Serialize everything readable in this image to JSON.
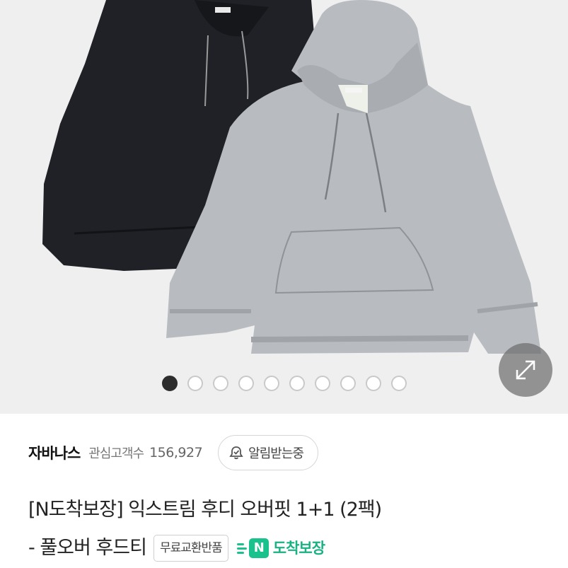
{
  "gallery": {
    "image": "product-photo-gray-black-hoodies",
    "slide_count": 10,
    "active_index": 0,
    "expand_icon": "expand-arrows-icon"
  },
  "store": {
    "name": "자바나스",
    "followers_label": "관심고객수",
    "followers_count": "156,927",
    "alarm_icon": "bell-icon",
    "alarm_label": "알림받는중"
  },
  "product": {
    "title_line1": "[N도착보장] 익스트림 후디 오버핏 1+1 (2팩)",
    "title_line2": "- 풀오버 후드티",
    "badge_return": "무료교환반품",
    "badge_delivery_icon": "N",
    "badge_delivery": "도착보장"
  },
  "colors": {
    "gallery_bg": "#efefef",
    "delivery_green": "#19c28c",
    "dot_active": "#2d2d2d"
  }
}
